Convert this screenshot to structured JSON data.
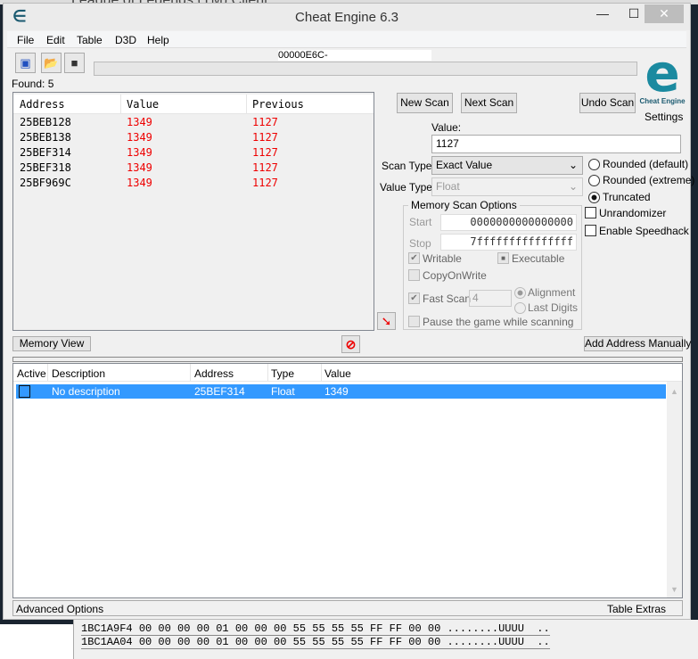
{
  "background_window_title": "League of Legends (TM) Client",
  "window": {
    "title": "Cheat Engine 6.3",
    "minimize": "—",
    "maximize": "☐",
    "close": "✕"
  },
  "menu": [
    "File",
    "Edit",
    "Table",
    "D3D",
    "Help"
  ],
  "toolbar": {
    "icons": [
      "open-process-icon",
      "open-folder-icon",
      "save-icon"
    ]
  },
  "process_label": "00000E6C-",
  "scan_progress": 0,
  "found": "Found: 5",
  "results": {
    "headers": [
      "Address",
      "Value",
      "Previous"
    ],
    "rows": [
      [
        "25BEB128",
        "1349",
        "1127"
      ],
      [
        "25BEB138",
        "1349",
        "1127"
      ],
      [
        "25BEF314",
        "1349",
        "1127"
      ],
      [
        "25BEF318",
        "1349",
        "1127"
      ],
      [
        "25BF969C",
        "1349",
        "1127"
      ]
    ]
  },
  "scan": {
    "new_scan": "New Scan",
    "next_scan": "Next Scan",
    "undo_scan": "Undo Scan",
    "logo_text": "Cheat Engine",
    "settings": "Settings",
    "value_label": "Value:",
    "value": "1127",
    "scan_type_label": "Scan Type",
    "scan_type": "Exact Value",
    "value_type_label": "Value Type",
    "value_type": "Float",
    "rounding": [
      "Rounded (default)",
      "Rounded (extreme)",
      "Truncated"
    ],
    "rounding_selected": "Truncated",
    "unrandomizer": "Unrandomizer",
    "speedhack": "Enable Speedhack",
    "mem_options": {
      "title": "Memory Scan Options",
      "start_label": "Start",
      "start": "0000000000000000",
      "stop_label": "Stop",
      "stop": "7fffffffffffffff",
      "writable": "Writable",
      "executable": "Executable",
      "copyonwrite": "CopyOnWrite",
      "fast_scan": "Fast Scan",
      "fast_scan_value": "4",
      "alignment": "Alignment",
      "last_digits": "Last Digits",
      "pause": "Pause the game while scanning"
    }
  },
  "memory_view": "Memory View",
  "add_address": "Add Address Manually",
  "table": {
    "headers": [
      "Active",
      "Description",
      "Address",
      "Type",
      "Value"
    ],
    "rows": [
      [
        "",
        "No description",
        "25BEF314",
        "Float",
        "1349"
      ]
    ]
  },
  "bottom": {
    "advanced": "Advanced Options",
    "extras": "Table Extras"
  },
  "hex": [
    {
      "addr": "1BC1A9F4",
      "bytes": "00 00 00 00 01 00 00 00 55 55 55 55 FF FF 00 00",
      "ascii": "........UUUU  .."
    },
    {
      "addr": "1BC1AA04",
      "bytes": "00 00 00 00 01 00 00 00 55 55 55 55 FF FF 00 00",
      "ascii": "........UUUU  .."
    }
  ],
  "colors": {
    "selection": "#3399ff",
    "values_red": "#e00000",
    "logo": "#1b8aa0"
  }
}
